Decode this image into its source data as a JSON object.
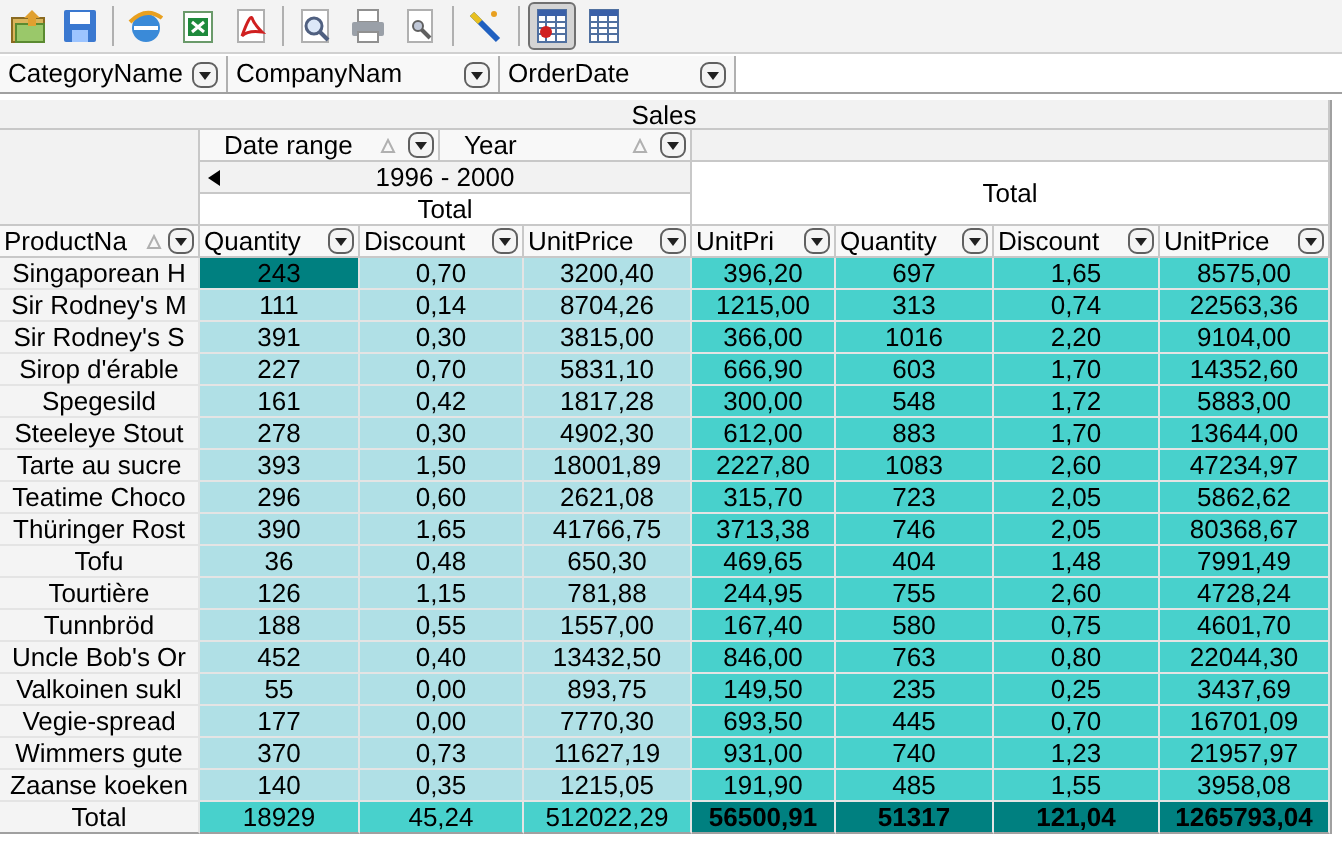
{
  "toolbar": [
    {
      "kind": "open",
      "pressed": false
    },
    {
      "kind": "save",
      "pressed": false
    },
    {
      "kind": "separator"
    },
    {
      "kind": "browser",
      "pressed": false
    },
    {
      "kind": "excel",
      "pressed": false
    },
    {
      "kind": "pdf",
      "pressed": false
    },
    {
      "kind": "separator"
    },
    {
      "kind": "preview",
      "pressed": false
    },
    {
      "kind": "print",
      "pressed": false
    },
    {
      "kind": "page_setup",
      "pressed": false
    },
    {
      "kind": "separator"
    },
    {
      "kind": "wand",
      "pressed": false
    },
    {
      "kind": "separator"
    },
    {
      "kind": "pivot",
      "pressed": true
    },
    {
      "kind": "grid",
      "pressed": false
    }
  ],
  "filter_fields": [
    {
      "label": "CategoryName"
    },
    {
      "label": "CompanyNam"
    },
    {
      "label": "OrderDate"
    }
  ],
  "grid": {
    "title": "Sales",
    "column_fields": [
      {
        "label": "Date range"
      },
      {
        "label": "Year"
      }
    ],
    "group": "1996 - 2000",
    "group_total": "Total",
    "grand_total": "Total",
    "row_field": "ProductNa",
    "measures": [
      "Quantity",
      "Discount",
      "UnitPrice",
      "UnitPri",
      "Quantity",
      "Discount",
      "UnitPrice"
    ],
    "rows": [
      {
        "product": "Singaporean H",
        "cells": [
          {
            "text": "243",
            "selected": true
          },
          {
            "text": "0,70",
            "selected": false
          },
          {
            "text": "3200,40",
            "selected": false
          },
          {
            "text": "396,20",
            "selected": false
          },
          {
            "text": "697",
            "selected": false
          },
          {
            "text": "1,65",
            "selected": false
          },
          {
            "text": "8575,00",
            "selected": false
          }
        ]
      },
      {
        "product": "Sir Rodney's M",
        "cells": [
          {
            "text": "111",
            "selected": false
          },
          {
            "text": "0,14",
            "selected": false
          },
          {
            "text": "8704,26",
            "selected": false
          },
          {
            "text": "1215,00",
            "selected": false
          },
          {
            "text": "313",
            "selected": false
          },
          {
            "text": "0,74",
            "selected": false
          },
          {
            "text": "22563,36",
            "selected": false
          }
        ]
      },
      {
        "product": "Sir Rodney's S",
        "cells": [
          {
            "text": "391",
            "selected": false
          },
          {
            "text": "0,30",
            "selected": false
          },
          {
            "text": "3815,00",
            "selected": false
          },
          {
            "text": "366,00",
            "selected": false
          },
          {
            "text": "1016",
            "selected": false
          },
          {
            "text": "2,20",
            "selected": false
          },
          {
            "text": "9104,00",
            "selected": false
          }
        ]
      },
      {
        "product": "Sirop d'érable",
        "cells": [
          {
            "text": "227",
            "selected": false
          },
          {
            "text": "0,70",
            "selected": false
          },
          {
            "text": "5831,10",
            "selected": false
          },
          {
            "text": "666,90",
            "selected": false
          },
          {
            "text": "603",
            "selected": false
          },
          {
            "text": "1,70",
            "selected": false
          },
          {
            "text": "14352,60",
            "selected": false
          }
        ]
      },
      {
        "product": "Spegesild",
        "cells": [
          {
            "text": "161",
            "selected": false
          },
          {
            "text": "0,42",
            "selected": false
          },
          {
            "text": "1817,28",
            "selected": false
          },
          {
            "text": "300,00",
            "selected": false
          },
          {
            "text": "548",
            "selected": false
          },
          {
            "text": "1,72",
            "selected": false
          },
          {
            "text": "5883,00",
            "selected": false
          }
        ]
      },
      {
        "product": "Steeleye Stout",
        "cells": [
          {
            "text": "278",
            "selected": false
          },
          {
            "text": "0,30",
            "selected": false
          },
          {
            "text": "4902,30",
            "selected": false
          },
          {
            "text": "612,00",
            "selected": false
          },
          {
            "text": "883",
            "selected": false
          },
          {
            "text": "1,70",
            "selected": false
          },
          {
            "text": "13644,00",
            "selected": false
          }
        ]
      },
      {
        "product": "Tarte au sucre",
        "cells": [
          {
            "text": "393",
            "selected": false
          },
          {
            "text": "1,50",
            "selected": false
          },
          {
            "text": "18001,89",
            "selected": false
          },
          {
            "text": "2227,80",
            "selected": false
          },
          {
            "text": "1083",
            "selected": false
          },
          {
            "text": "2,60",
            "selected": false
          },
          {
            "text": "47234,97",
            "selected": false
          }
        ]
      },
      {
        "product": "Teatime Choco",
        "cells": [
          {
            "text": "296",
            "selected": false
          },
          {
            "text": "0,60",
            "selected": false
          },
          {
            "text": "2621,08",
            "selected": false
          },
          {
            "text": "315,70",
            "selected": false
          },
          {
            "text": "723",
            "selected": false
          },
          {
            "text": "2,05",
            "selected": false
          },
          {
            "text": "5862,62",
            "selected": false
          }
        ]
      },
      {
        "product": "Thüringer Rost",
        "cells": [
          {
            "text": "390",
            "selected": false
          },
          {
            "text": "1,65",
            "selected": false
          },
          {
            "text": "41766,75",
            "selected": false
          },
          {
            "text": "3713,38",
            "selected": false
          },
          {
            "text": "746",
            "selected": false
          },
          {
            "text": "2,05",
            "selected": false
          },
          {
            "text": "80368,67",
            "selected": false
          }
        ]
      },
      {
        "product": "Tofu",
        "cells": [
          {
            "text": "36",
            "selected": false
          },
          {
            "text": "0,48",
            "selected": false
          },
          {
            "text": "650,30",
            "selected": false
          },
          {
            "text": "469,65",
            "selected": false
          },
          {
            "text": "404",
            "selected": false
          },
          {
            "text": "1,48",
            "selected": false
          },
          {
            "text": "7991,49",
            "selected": false
          }
        ]
      },
      {
        "product": "Tourtière",
        "cells": [
          {
            "text": "126",
            "selected": false
          },
          {
            "text": "1,15",
            "selected": false
          },
          {
            "text": "781,88",
            "selected": false
          },
          {
            "text": "244,95",
            "selected": false
          },
          {
            "text": "755",
            "selected": false
          },
          {
            "text": "2,60",
            "selected": false
          },
          {
            "text": "4728,24",
            "selected": false
          }
        ]
      },
      {
        "product": "Tunnbröd",
        "cells": [
          {
            "text": "188",
            "selected": false
          },
          {
            "text": "0,55",
            "selected": false
          },
          {
            "text": "1557,00",
            "selected": false
          },
          {
            "text": "167,40",
            "selected": false
          },
          {
            "text": "580",
            "selected": false
          },
          {
            "text": "0,75",
            "selected": false
          },
          {
            "text": "4601,70",
            "selected": false
          }
        ]
      },
      {
        "product": "Uncle Bob's Or",
        "cells": [
          {
            "text": "452",
            "selected": false
          },
          {
            "text": "0,40",
            "selected": false
          },
          {
            "text": "13432,50",
            "selected": false
          },
          {
            "text": "846,00",
            "selected": false
          },
          {
            "text": "763",
            "selected": false
          },
          {
            "text": "0,80",
            "selected": false
          },
          {
            "text": "22044,30",
            "selected": false
          }
        ]
      },
      {
        "product": "Valkoinen sukl",
        "cells": [
          {
            "text": "55",
            "selected": false
          },
          {
            "text": "0,00",
            "selected": false
          },
          {
            "text": "893,75",
            "selected": false
          },
          {
            "text": "149,50",
            "selected": false
          },
          {
            "text": "235",
            "selected": false
          },
          {
            "text": "0,25",
            "selected": false
          },
          {
            "text": "3437,69",
            "selected": false
          }
        ]
      },
      {
        "product": "Vegie-spread",
        "cells": [
          {
            "text": "177",
            "selected": false
          },
          {
            "text": "0,00",
            "selected": false
          },
          {
            "text": "7770,30",
            "selected": false
          },
          {
            "text": "693,50",
            "selected": false
          },
          {
            "text": "445",
            "selected": false
          },
          {
            "text": "0,70",
            "selected": false
          },
          {
            "text": "16701,09",
            "selected": false
          }
        ]
      },
      {
        "product": "Wimmers gute",
        "cells": [
          {
            "text": "370",
            "selected": false
          },
          {
            "text": "0,73",
            "selected": false
          },
          {
            "text": "11627,19",
            "selected": false
          },
          {
            "text": "931,00",
            "selected": false
          },
          {
            "text": "740",
            "selected": false
          },
          {
            "text": "1,23",
            "selected": false
          },
          {
            "text": "21957,97",
            "selected": false
          }
        ]
      },
      {
        "product": "Zaanse koeken",
        "cells": [
          {
            "text": "140",
            "selected": false
          },
          {
            "text": "0,35",
            "selected": false
          },
          {
            "text": "1215,05",
            "selected": false
          },
          {
            "text": "191,90",
            "selected": false
          },
          {
            "text": "485",
            "selected": false
          },
          {
            "text": "1,55",
            "selected": false
          },
          {
            "text": "3958,08",
            "selected": false
          }
        ]
      }
    ],
    "totals": {
      "label": "Total",
      "cells": [
        "18929",
        "45,24",
        "512022,29",
        "56500,91",
        "51317",
        "121,04",
        "1265793,04"
      ]
    }
  }
}
